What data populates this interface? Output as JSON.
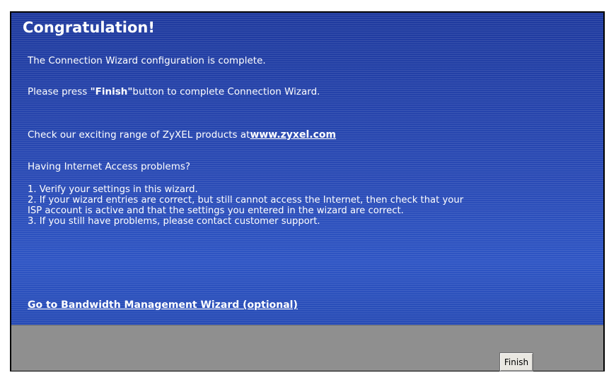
{
  "wizard": {
    "title": "Congratulation!",
    "complete_text": "The Connection Wizard configuration is complete.",
    "press_prefix": "Please press ",
    "press_bold": "\"Finish\"",
    "press_suffix": "button to complete Connection Wizard.",
    "check_text": "Check our exciting range of ZyXEL products at",
    "check_link": "www.zyxel.com",
    "problems_heading": "Having Internet Access problems?",
    "steps": [
      "1. Verify your settings in this wizard.",
      "2. If your wizard entries are correct, but still cannot access the Internet, then check that your",
      "ISP account is active and that the settings you entered in the wizard are correct.",
      "3. If you still have problems, please contact customer support."
    ],
    "bandwidth_link": "Go to Bandwidth Management Wizard (optional)",
    "finish_label": "Finish"
  },
  "colors": {
    "panel_blue": "#2241a8",
    "footer_gray": "#8f8f8f",
    "text": "#ffffff"
  }
}
